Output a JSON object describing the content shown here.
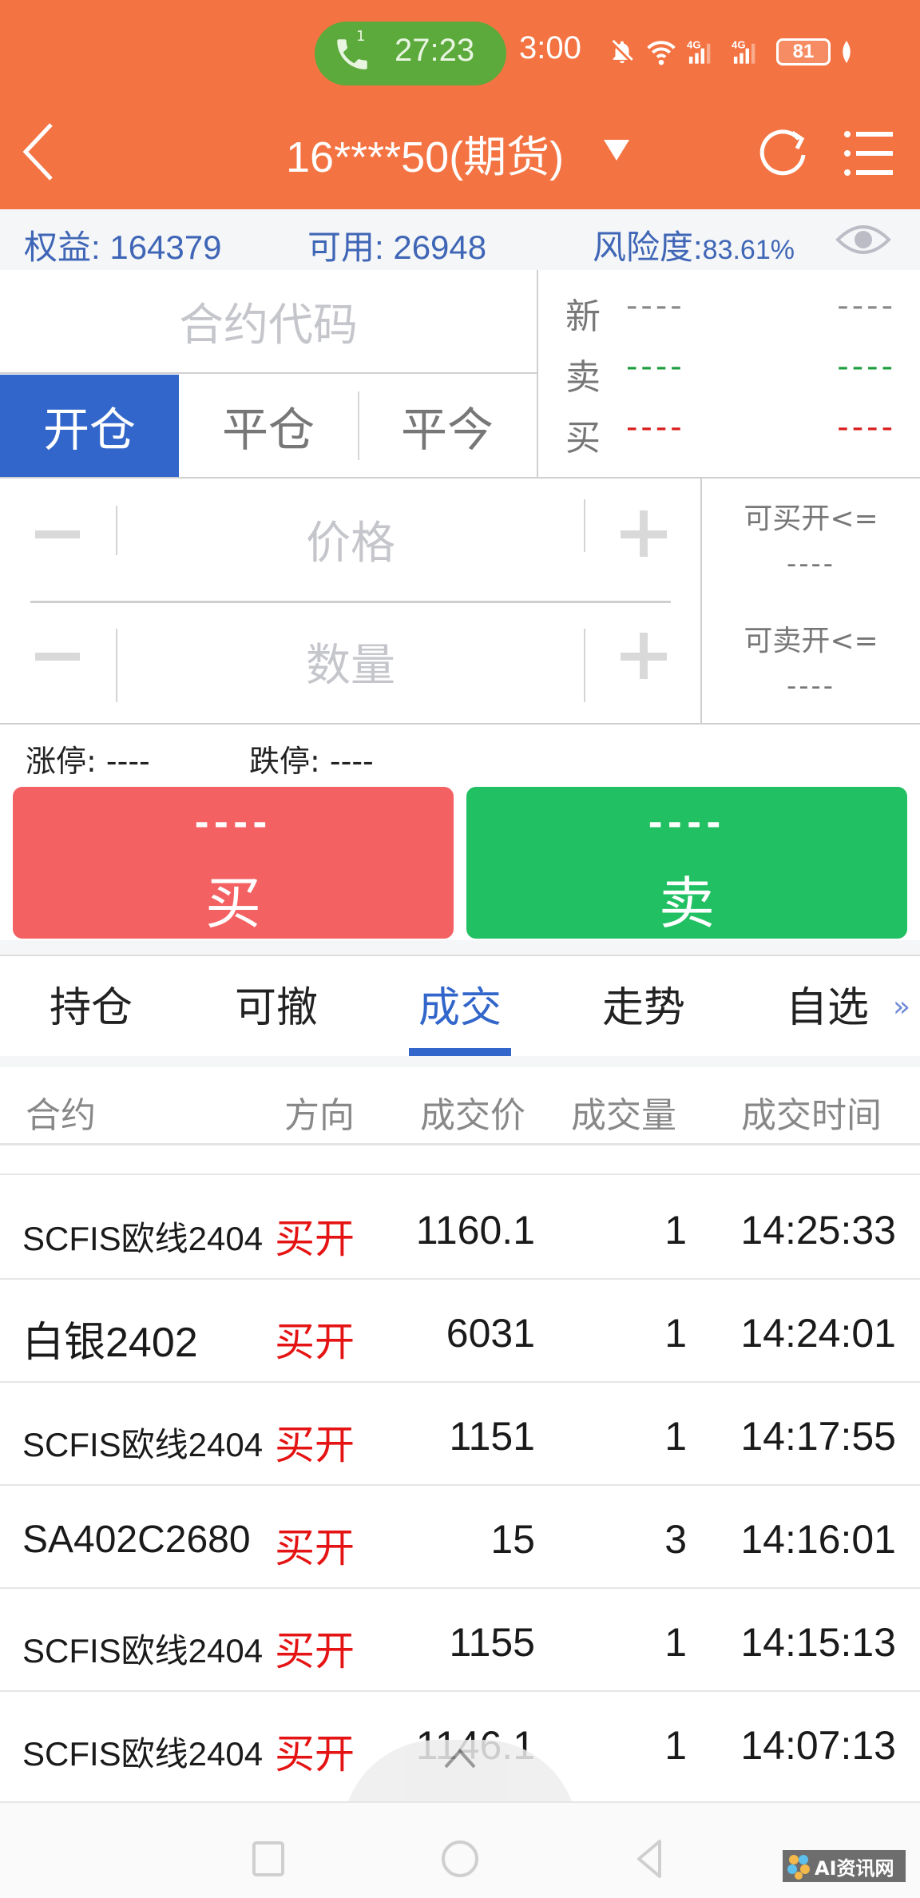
{
  "status_bar": {
    "call_sim": "1",
    "call_timer": "27:23",
    "time": "3:00",
    "battery": "81"
  },
  "header": {
    "title": "16****50(期货)",
    "colors": {
      "header_bg": "#F47342",
      "call_pill": "#5CAA3B"
    }
  },
  "account": {
    "equity_label": "权益:",
    "equity_value": "164379",
    "available_label": "可用:",
    "available_value": "26948",
    "risk_label": "风险度:",
    "risk_value": "83.61%"
  },
  "order": {
    "contract_placeholder": "合约代码",
    "mode_tabs": [
      {
        "label": "开仓",
        "active": true
      },
      {
        "label": "平仓",
        "active": false
      },
      {
        "label": "平今",
        "active": false
      }
    ],
    "quote": [
      {
        "label": "新",
        "left": "----",
        "right": "----",
        "color": "#888888"
      },
      {
        "label": "卖",
        "left": "----",
        "right": "----",
        "color": "#1E9E3F"
      },
      {
        "label": "买",
        "left": "----",
        "right": "----",
        "color": "#D91A1A"
      }
    ],
    "price_placeholder": "价格",
    "quantity_placeholder": "数量",
    "can_buy_open_label": "可买开<=",
    "can_buy_open_value": "----",
    "can_sell_open_label": "可卖开<=",
    "can_sell_open_value": "----",
    "limit_up_label": "涨停:",
    "limit_up_value": "----",
    "limit_down_label": "跌停:",
    "limit_down_value": "----",
    "buy_button": {
      "price": "----",
      "label": "买",
      "color": "#F46163"
    },
    "sell_button": {
      "price": "----",
      "label": "卖",
      "color": "#21C063"
    }
  },
  "tabs": {
    "items": [
      {
        "label": "持仓",
        "active": false
      },
      {
        "label": "可撤",
        "active": false
      },
      {
        "label": "成交",
        "active": true
      },
      {
        "label": "走势",
        "active": false
      },
      {
        "label": "自选",
        "active": false
      }
    ],
    "more": "»",
    "accent": "#3266CA"
  },
  "trades": {
    "columns": [
      "合约",
      "方向",
      "成交价",
      "成交量",
      "成交时间"
    ],
    "rows": [
      {
        "contract": "SCFIS欧线2404",
        "direction": "买开",
        "price": "1160.1",
        "qty": "1",
        "time": "14:25:33"
      },
      {
        "contract": "白银2402",
        "direction": "买开",
        "price": "6031",
        "qty": "1",
        "time": "14:24:01"
      },
      {
        "contract": "SCFIS欧线2404",
        "direction": "买开",
        "price": "1151",
        "qty": "1",
        "time": "14:17:55"
      },
      {
        "contract": "SA402C2680",
        "direction": "买开",
        "price": "15",
        "qty": "3",
        "time": "14:16:01"
      },
      {
        "contract": "SCFIS欧线2404",
        "direction": "买开",
        "price": "1155",
        "qty": "1",
        "time": "14:15:13"
      },
      {
        "contract": "SCFIS欧线2404",
        "direction": "买开",
        "price": "1146.1",
        "qty": "1",
        "time": "14:07:13"
      }
    ]
  },
  "watermark": "AI资讯网"
}
